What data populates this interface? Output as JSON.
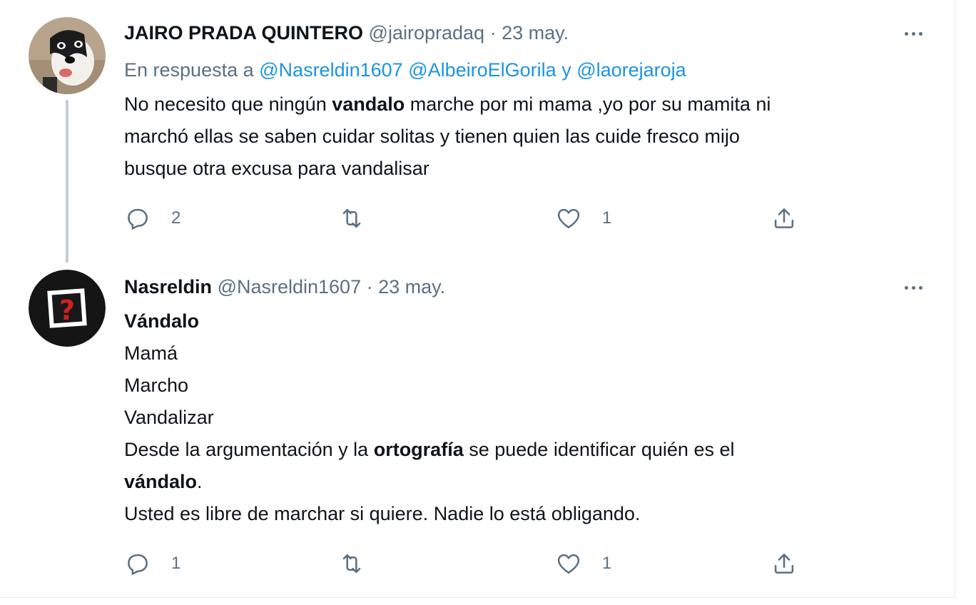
{
  "tweets": [
    {
      "name": "JAIRO PRADA QUINTERO",
      "handle": "@jairopradaq",
      "separator": "·",
      "date": "23 may.",
      "reply_prefix": "En respuesta a",
      "reply_mentions": [
        "@Nasreldin1607",
        "@AlbeiroElGorila",
        "@laorejaroja"
      ],
      "reply_joiner": "y",
      "body": {
        "l1_a": "No necesito que ningún ",
        "l1_b": "vandalo",
        "l1_c": " marche por mi mama ,yo por su mamita ni",
        "l2": "marchó ellas se saben cuidar solitas y tienen quien las cuide fresco mijo",
        "l3": "busque otra excusa para vandalisar"
      },
      "reply_count": "2",
      "retweet_count": "",
      "like_count": "1"
    },
    {
      "name": "Nasreldin",
      "handle": "@Nasreldin1607",
      "separator": "·",
      "date": "23 may.",
      "body": {
        "l1": "Vándalo",
        "l2": "Mamá",
        "l3": "Marcho",
        "l4": "Vandalizar",
        "l5_a": "Desde la argumentación y la ",
        "l5_b": "ortografía",
        "l5_c": " se puede identificar quién es el",
        "l6_a": "vándalo",
        "l6_b": ".",
        "l7": "Usted es libre de marchar si quiere. Nadie lo está obligando."
      },
      "reply_count": "1",
      "retweet_count": "",
      "like_count": "1"
    }
  ],
  "icons": {
    "reply": "reply-icon",
    "retweet": "retweet-icon",
    "like": "heart-icon",
    "share": "share-icon",
    "more": "more-options-icon"
  },
  "colors": {
    "text": "#0f1419",
    "secondary": "#5b7083",
    "link": "#1b95e0",
    "thread_line": "#c4cfd6",
    "border": "#e6ecf0"
  }
}
